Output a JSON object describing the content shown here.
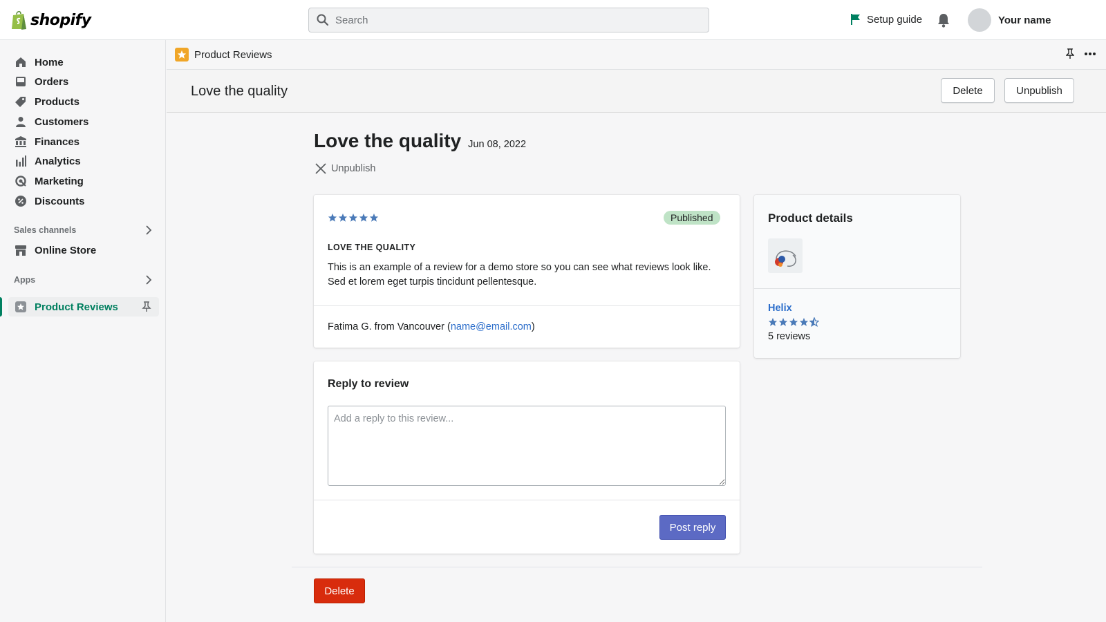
{
  "brand": {
    "name": "shopify",
    "color": "#95bf47"
  },
  "topbar": {
    "search_placeholder": "Search",
    "setup_guide": "Setup guide",
    "user_name": "Your name"
  },
  "sidebar": {
    "items": [
      {
        "label": "Home",
        "icon": "home-icon"
      },
      {
        "label": "Orders",
        "icon": "inbox-icon"
      },
      {
        "label": "Products",
        "icon": "tag-icon"
      },
      {
        "label": "Customers",
        "icon": "person-icon"
      },
      {
        "label": "Finances",
        "icon": "bank-icon"
      },
      {
        "label": "Analytics",
        "icon": "bar-chart-icon"
      },
      {
        "label": "Marketing",
        "icon": "target-icon"
      },
      {
        "label": "Discounts",
        "icon": "discount-icon"
      }
    ],
    "sales_channels_title": "Sales channels",
    "online_store": "Online Store",
    "apps_title": "Apps",
    "active_app": "Product Reviews"
  },
  "app_strip": {
    "app_name": "Product Reviews"
  },
  "title_bar": {
    "title": "Love the quality",
    "delete_label": "Delete",
    "unpublish_label": "Unpublish"
  },
  "main": {
    "heading": "Love the quality",
    "date": "Jun 08, 2022",
    "unpublish_link": "Unpublish"
  },
  "review": {
    "rating": 5,
    "status": "Published",
    "title": "LOVE THE QUALITY",
    "body": "This is an example of a review for a demo store so you can see what reviews look like. Sed et lorem eget turpis tincidunt pellentesque.",
    "author_prefix": "Fatima G. from Vancouver (",
    "email": "name@email.com",
    "author_suffix": ")"
  },
  "reply": {
    "title": "Reply to review",
    "placeholder": "Add a reply to this review...",
    "post_label": "Post reply"
  },
  "product": {
    "title": "Product details",
    "name": "Helix",
    "rating": 4.5,
    "reviews": "5 reviews"
  },
  "footer": {
    "delete_label": "Delete"
  },
  "colors": {
    "star": "#4a7ab8",
    "primary": "#5c6ac4",
    "destructive": "#d82c0d",
    "link": "#2c6ecb",
    "active_green": "#008060"
  }
}
